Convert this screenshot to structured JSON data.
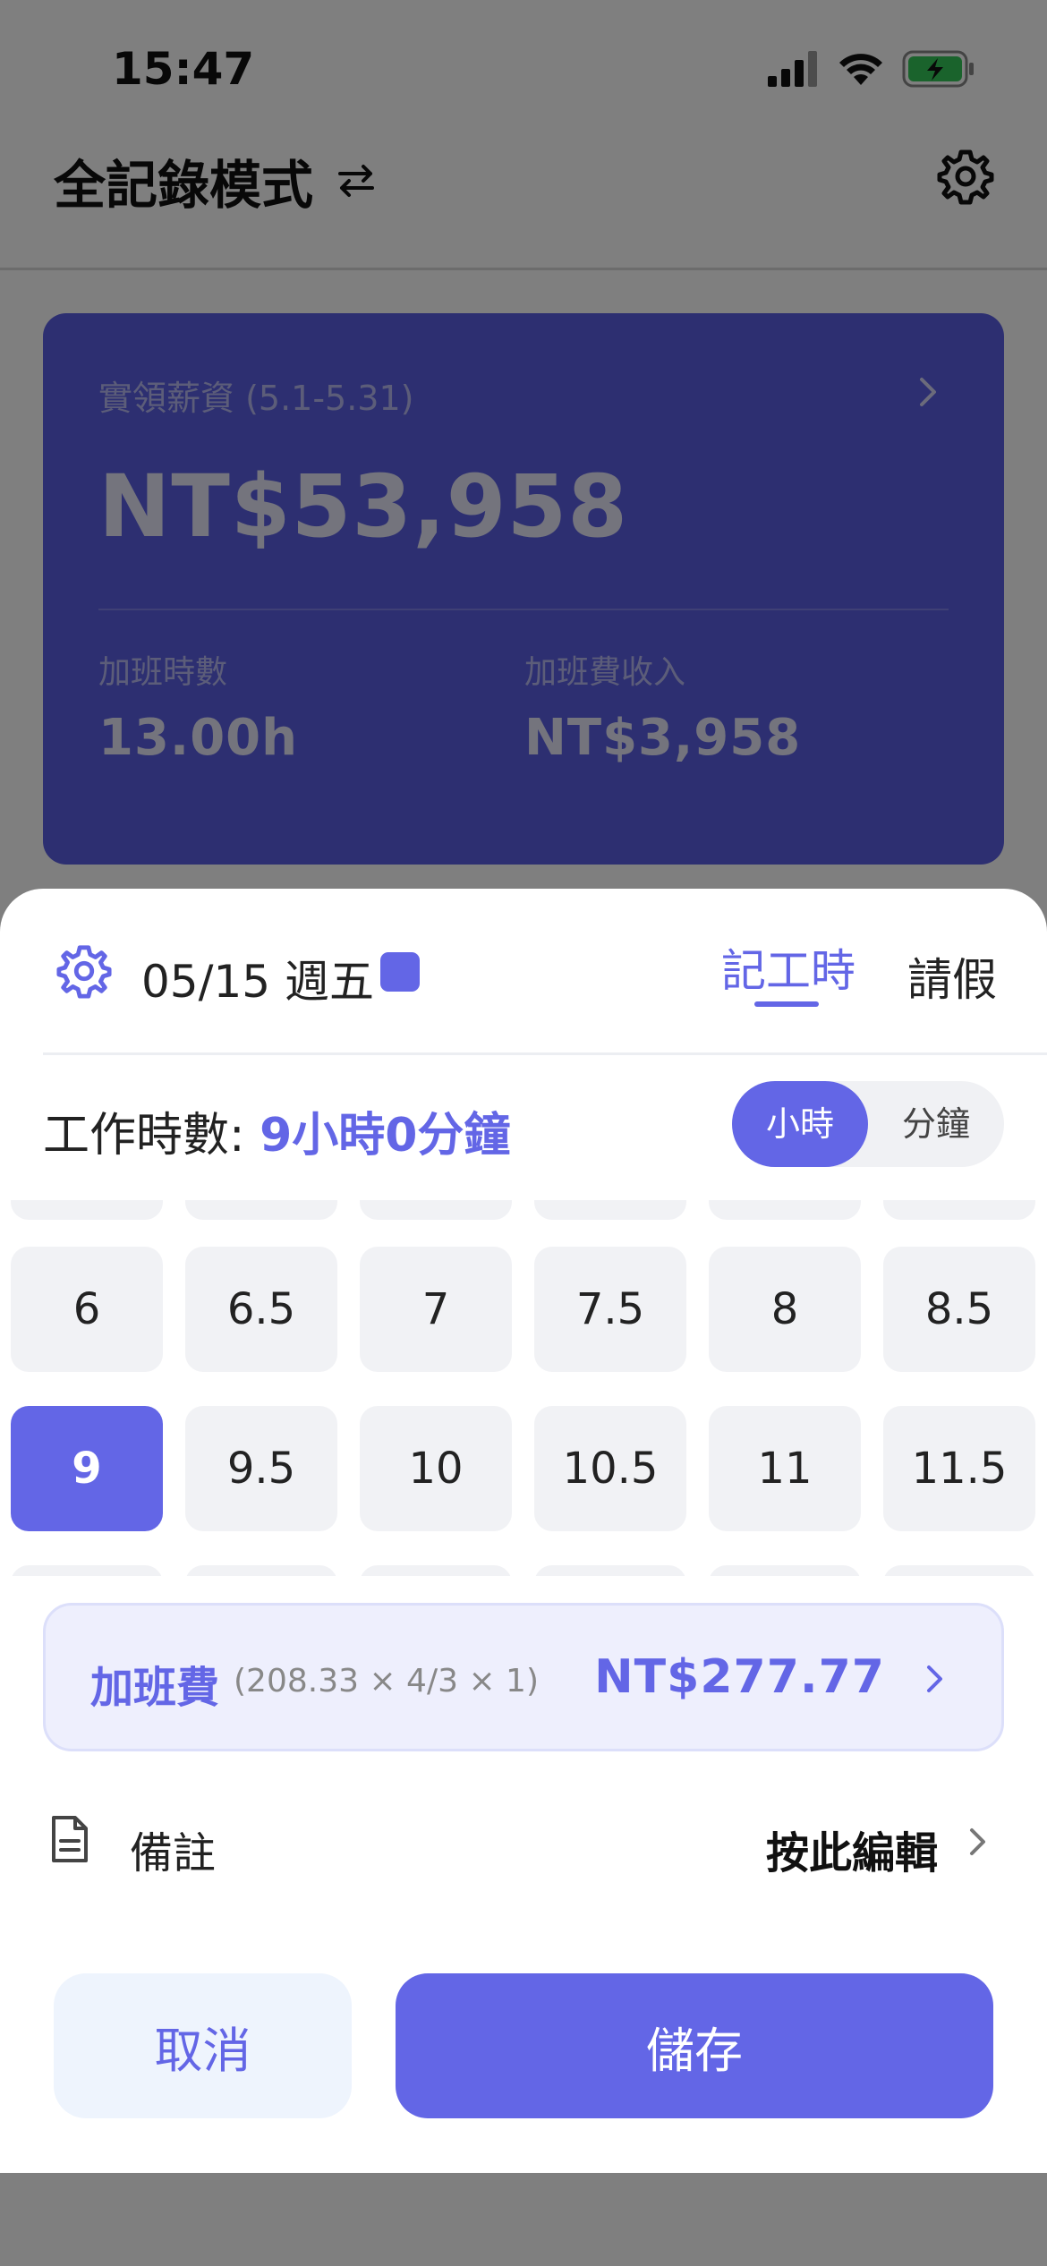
{
  "status_bar": {
    "time": "15:47"
  },
  "nav": {
    "title": "全記錄模式"
  },
  "salary_card": {
    "label": "實領薪資 (5.1-5.31)",
    "amount": "NT$53,958",
    "overtime_hours_label": "加班時數",
    "overtime_hours_value": "13.00h",
    "overtime_income_label": "加班費收入",
    "overtime_income_value": "NT$3,958"
  },
  "sheet": {
    "date": "05/15 週五",
    "tabs": {
      "record": "記工時",
      "leave": "請假"
    },
    "work_hours_label": "工作時數: ",
    "work_hours_value": "9小時0分鐘",
    "unit_toggle": {
      "hour": "小時",
      "minute": "分鐘",
      "selected": "hour"
    },
    "hour_grid": [
      [
        "6",
        "6.5",
        "7",
        "7.5",
        "8",
        "8.5"
      ],
      [
        "9",
        "9.5",
        "10",
        "10.5",
        "11",
        "11.5"
      ]
    ],
    "selected_hour": "9",
    "overtime": {
      "label": "加班費",
      "formula": "(208.33 × 4/3 × 1)",
      "amount": "NT$277.77"
    },
    "note": {
      "label": "備註",
      "action": "按此編輯"
    },
    "buttons": {
      "cancel": "取消",
      "save": "儲存"
    }
  },
  "colors": {
    "accent": "#6366e6",
    "card": "#5b5fe3",
    "cell": "#f1f2f5"
  },
  "icons": [
    "signal-icon",
    "wifi-icon",
    "battery-charging-icon",
    "swap-icon",
    "gear-icon",
    "chevron-right-icon",
    "document-icon"
  ]
}
